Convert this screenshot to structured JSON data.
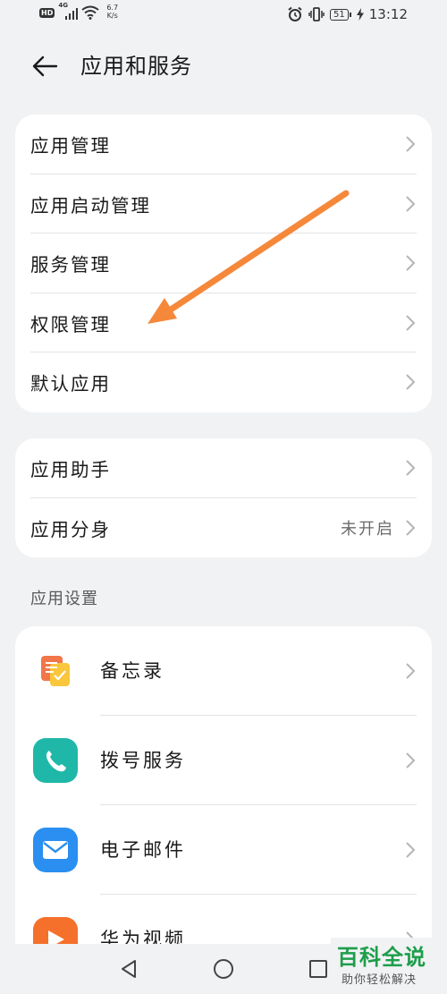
{
  "status_bar": {
    "hd": "HD",
    "network_gen": "4G",
    "speed_value": "6.7",
    "speed_unit": "K/s",
    "battery": "51",
    "time": "13:12"
  },
  "header": {
    "title": "应用和服务"
  },
  "group1": [
    {
      "label": "应用管理"
    },
    {
      "label": "应用启动管理"
    },
    {
      "label": "服务管理"
    },
    {
      "label": "权限管理"
    },
    {
      "label": "默认应用"
    }
  ],
  "group2": [
    {
      "label": "应用助手"
    },
    {
      "label": "应用分身",
      "value": "未开启"
    }
  ],
  "section": {
    "title": "应用设置"
  },
  "apps": [
    {
      "label": "备忘录",
      "icon": "memo-icon"
    },
    {
      "label": "拨号服务",
      "icon": "phone-icon"
    },
    {
      "label": "电子邮件",
      "icon": "email-icon"
    },
    {
      "label": "华为视频",
      "icon": "video-icon"
    }
  ],
  "watermark": {
    "title": "百科全说",
    "subtitle": "助你轻松解决"
  },
  "colors": {
    "background": "#f1f2f4",
    "card": "#ffffff",
    "annotation_arrow": "#f5883a",
    "watermark_green": "#1d9e4a"
  }
}
